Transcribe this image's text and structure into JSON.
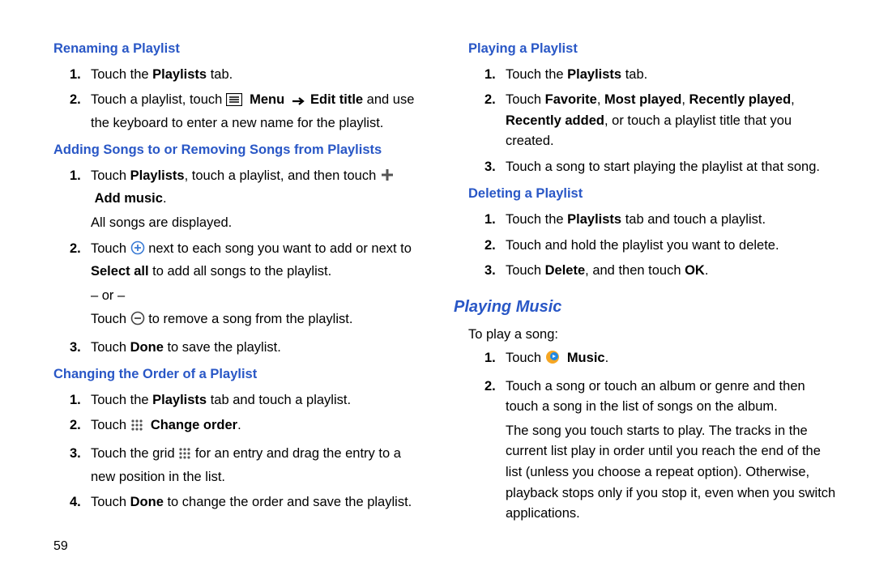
{
  "pageNumber": "59",
  "left": {
    "s1": {
      "title": "Renaming a Playlist",
      "step1": "Touch the ",
      "step1b": "Playlists",
      "step1c": " tab.",
      "step2a": "Touch a playlist, touch ",
      "step2b": "Menu",
      "step2c": "Edit title",
      "step2d": " and use the keyboard to enter a new name for the playlist."
    },
    "s2": {
      "title": "Adding Songs to or Removing Songs from Playlists",
      "step1a": "Touch ",
      "step1b": "Playlists",
      "step1c": ", touch a playlist, and then touch ",
      "step1d": "Add music",
      "step1e": ".",
      "step1f": "All songs are displayed.",
      "step2a": "Touch ",
      "step2b": " next to each song you want to add or next to ",
      "step2c": "Select all",
      "step2d": " to add all songs to the playlist.",
      "step2e": "– or –",
      "step2f": "Touch ",
      "step2g": " to remove a song from the playlist.",
      "step3a": "Touch ",
      "step3b": "Done",
      "step3c": " to save the playlist."
    },
    "s3": {
      "title": "Changing the Order of a Playlist",
      "step1a": "Touch the ",
      "step1b": "Playlists",
      "step1c": " tab and touch a playlist.",
      "step2a": "Touch ",
      "step2b": "Change order",
      "step2c": ".",
      "step3a": "Touch the grid ",
      "step3b": " for an entry and drag the entry to a new position in the list.",
      "step4a": "Touch ",
      "step4b": "Done",
      "step4c": " to change the order and save the playlist."
    }
  },
  "right": {
    "s4": {
      "title": "Playing a Playlist",
      "step1a": "Touch the ",
      "step1b": "Playlists",
      "step1c": " tab.",
      "step2a": "Touch ",
      "step2b": "Favorite",
      "step2c": ", ",
      "step2d": "Most played",
      "step2e": ", ",
      "step2f": "Recently played",
      "step2g": ", ",
      "step2h": "Recently added",
      "step2i": ", or touch a playlist title that you created.",
      "step3": "Touch a song to start playing the playlist at that song."
    },
    "s5": {
      "title": "Deleting a Playlist",
      "step1a": "Touch the ",
      "step1b": "Playlists",
      "step1c": " tab and touch a playlist.",
      "step2": "Touch and hold the playlist you want to delete.",
      "step3a": "Touch ",
      "step3b": "Delete",
      "step3c": ", and then touch ",
      "step3d": "OK",
      "step3e": "."
    },
    "s6": {
      "title": "Playing Music",
      "intro": "To play a song:",
      "step1a": "Touch ",
      "step1b": "Music",
      "step1c": ".",
      "step2": "Touch a song or touch an album or genre and then touch a song in the list of songs on the album.",
      "step2b": "The song you touch starts to play. The tracks in the current list play in order until you reach the end of the list (unless you choose a repeat option). Otherwise, playback stops only if you stop it, even when you switch applications."
    }
  }
}
